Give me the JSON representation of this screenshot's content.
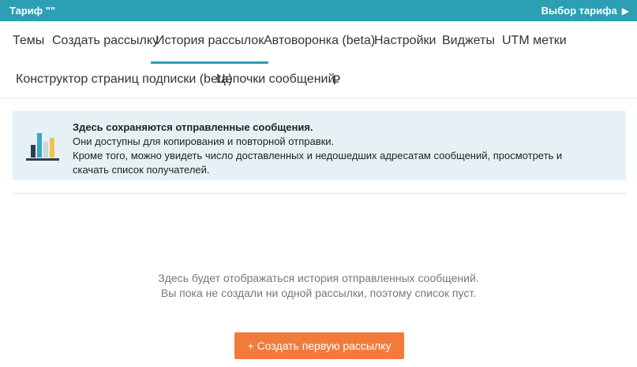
{
  "topbar": {
    "plan_label": "Тариф \"\"",
    "choose_plan_label": "Выбор тарифа",
    "choose_plan_arrow": "▶"
  },
  "nav": {
    "row1": [
      "Темы",
      "Создать рассылку",
      "История рассылок",
      "Автоворонка (beta)",
      "Настройки",
      "Виджеты",
      "UTM метки"
    ],
    "row2": [
      "Конструктор страниц подписки (beta)",
      "Цепочки сообщений",
      "₽"
    ],
    "active": "История рассылок"
  },
  "info": {
    "title": "Здесь сохраняются отправленные сообщения.",
    "line1": "Они доступны для копирования и повторной отправки.",
    "line2": "Кроме того, можно увидеть число доставленных и недошедших адресатам сообщений, просмотреть и",
    "line3": "скачать список получателей.",
    "icon": "bar-chart-icon"
  },
  "empty_state": {
    "line1": "Здесь будет отображаться история отправленных сообщений.",
    "line2": "Вы пока не создали ни одной рассылки, поэтому список пуст."
  },
  "cta_label": "+ Создать первую рассылку",
  "colors": {
    "accent": "#2d9fb4",
    "cta": "#f27b3a",
    "info_bg": "#e6f1f5"
  }
}
